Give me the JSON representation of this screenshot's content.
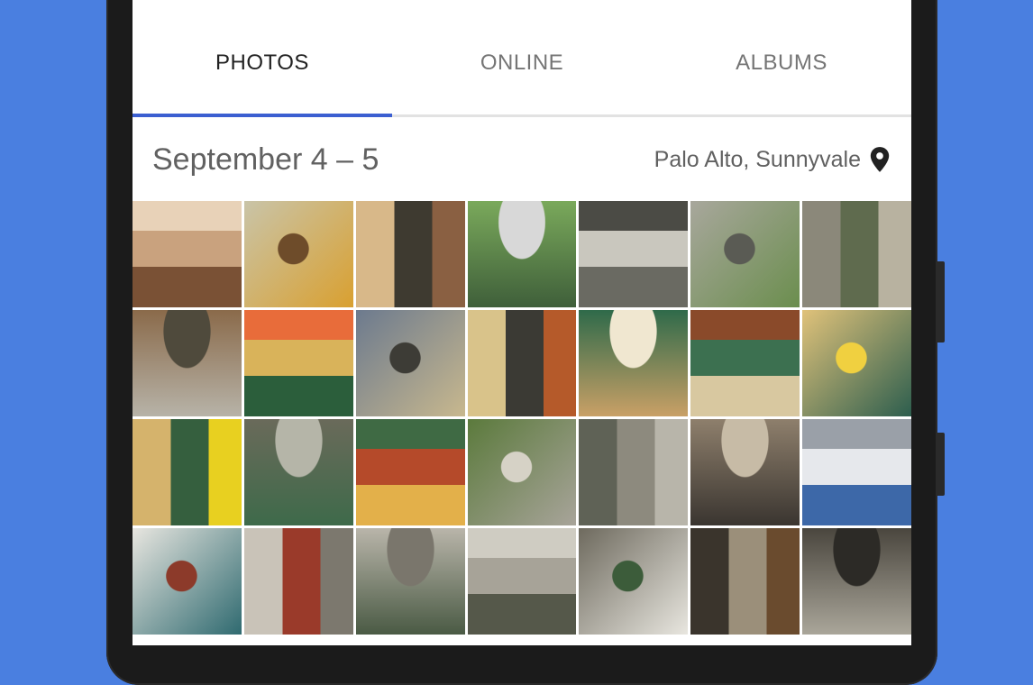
{
  "tabs": [
    {
      "label": "PHOTOS",
      "active": true
    },
    {
      "label": "ONLINE",
      "active": false
    },
    {
      "label": "ALBUMS",
      "active": false
    }
  ],
  "section": {
    "date": "September 4 – 5",
    "location": "Palo Alto, Sunnyvale",
    "location_icon": "map-pin-icon"
  },
  "colors": {
    "background": "#4a7fe0",
    "tab_indicator": "#3b5fd1",
    "text_primary": "#222222",
    "text_secondary": "#616161"
  },
  "photos": [
    {
      "name": "photo-selfie-woman",
      "colors": [
        "#c9a27e",
        "#7a5135",
        "#e8d2b8"
      ]
    },
    {
      "name": "photo-man-flowers",
      "colors": [
        "#c9c4a8",
        "#d9a030",
        "#6e4c2a"
      ]
    },
    {
      "name": "photo-three-women",
      "colors": [
        "#d8b889",
        "#3e3a30",
        "#8a6042"
      ]
    },
    {
      "name": "photo-runner-park",
      "colors": [
        "#7aa95b",
        "#3f5f3a",
        "#d8d8d8"
      ]
    },
    {
      "name": "photo-building-door",
      "colors": [
        "#c9c7be",
        "#6a6a62",
        "#4b4b45"
      ]
    },
    {
      "name": "photo-tree-building",
      "colors": [
        "#a8a79c",
        "#6b8e4e",
        "#5a5b54"
      ]
    },
    {
      "name": "photo-building-wall",
      "colors": [
        "#8b887a",
        "#5f6b4e",
        "#b8b2a0"
      ]
    },
    {
      "name": "photo-street-shops",
      "colors": [
        "#8a6a4a",
        "#b7b3a8",
        "#4f4a3c"
      ]
    },
    {
      "name": "photo-yellow-arches",
      "colors": [
        "#d9b35a",
        "#2b5e3b",
        "#e86c3a"
      ]
    },
    {
      "name": "photo-plaza-view",
      "colors": [
        "#6c7a8e",
        "#c8b88e",
        "#3d3c36"
      ]
    },
    {
      "name": "photo-arch-facade",
      "colors": [
        "#d9c38a",
        "#3b3a34",
        "#b55a2a"
      ]
    },
    {
      "name": "photo-market-awning",
      "colors": [
        "#2f6a4a",
        "#c9a066",
        "#f0e7d0"
      ]
    },
    {
      "name": "photo-produce-stand",
      "colors": [
        "#3c7050",
        "#d8c8a0",
        "#8a4a2a"
      ]
    },
    {
      "name": "photo-cafe-umbrellas",
      "colors": [
        "#e0c27a",
        "#2d5e4e",
        "#f0d040"
      ]
    },
    {
      "name": "photo-courtyard-cafe",
      "colors": [
        "#d5b36c",
        "#355f3e",
        "#e8d020"
      ]
    },
    {
      "name": "photo-green-awning",
      "colors": [
        "#6a6a5a",
        "#3e6a4a",
        "#b5b5a8"
      ]
    },
    {
      "name": "photo-fruit-market",
      "colors": [
        "#b54a2a",
        "#e3b04a",
        "#3f6a44"
      ]
    },
    {
      "name": "photo-tree-sidewalk",
      "colors": [
        "#5b7a3c",
        "#a8a49a",
        "#d6d2c6"
      ]
    },
    {
      "name": "photo-shop-window",
      "colors": [
        "#5f6256",
        "#8d8a7e",
        "#b8b5aa"
      ]
    },
    {
      "name": "photo-archway-interior",
      "colors": [
        "#8e7f6c",
        "#3a3530",
        "#c7bba6"
      ]
    },
    {
      "name": "photo-white-storefront",
      "colors": [
        "#e6e8ec",
        "#3d68a8",
        "#9aa0a8"
      ]
    },
    {
      "name": "photo-teal-storefront",
      "colors": [
        "#e8e6e0",
        "#2f6a70",
        "#8c3a2a"
      ]
    },
    {
      "name": "photo-courtyard-bench",
      "colors": [
        "#c9c3b8",
        "#9a3a2a",
        "#7c786e"
      ]
    },
    {
      "name": "photo-arcade-walk",
      "colors": [
        "#b9b5aa",
        "#4a5a44",
        "#7a766c"
      ]
    },
    {
      "name": "photo-arcade-shops",
      "colors": [
        "#a7a398",
        "#55584a",
        "#cfccc2"
      ]
    },
    {
      "name": "photo-umbrella-patio",
      "colors": [
        "#6e6a5e",
        "#e8e6df",
        "#3c5c3a"
      ]
    },
    {
      "name": "photo-dark-corridor",
      "colors": [
        "#3a342c",
        "#9b8f7a",
        "#6a4b2e"
      ]
    },
    {
      "name": "photo-lobby-interior",
      "colors": [
        "#4a463e",
        "#aaa69a",
        "#2c2a26"
      ]
    }
  ]
}
